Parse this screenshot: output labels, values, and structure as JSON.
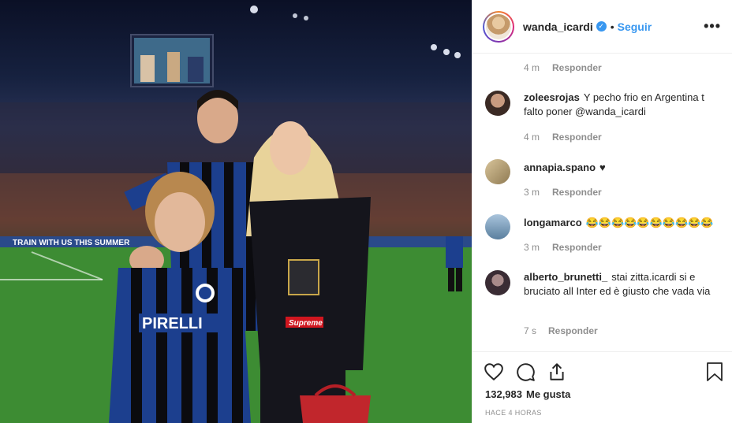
{
  "post": {
    "photo_alt": "",
    "banner_text": "TRAIN WITH US THIS SUMMER",
    "shirt_sponsor": "PIRELLI",
    "bag_label": "Supreme"
  },
  "header": {
    "username": "wanda_icardi",
    "verified_mark": "✓",
    "separator": "•",
    "follow_label": "Seguir",
    "more_label": "•••"
  },
  "comments": [
    {
      "username": "",
      "text": "",
      "time": "4 m",
      "reply_label": "Responder",
      "avatar_color": "#ffffff"
    },
    {
      "username": "zoleesrojas",
      "text": "Y pecho frio en Argentina t falto poner @wanda_icardi",
      "time": "4 m",
      "reply_label": "Responder",
      "avatar_color": "#6b4a3a"
    },
    {
      "username": "annapia.spano",
      "text": "♥",
      "time": "3 m",
      "reply_label": "Responder",
      "avatar_color": "#b8a27c"
    },
    {
      "username": "longamarco",
      "text": "😂😂😂😂😂😂😂😂😂😂",
      "time": "3 m",
      "reply_label": "Responder",
      "avatar_color": "#7aa0c4"
    },
    {
      "username": "alberto_brunetti_",
      "text": "stai zitta.icardi si e bruciato all Inter ed è giusto che vada via",
      "time": "7 s",
      "reply_label": "Responder",
      "avatar_color": "#4b3a44"
    }
  ],
  "actions": {
    "like_icon": "heart-icon",
    "comment_icon": "comment-icon",
    "share_icon": "share-icon",
    "save_icon": "bookmark-icon"
  },
  "likes": {
    "count": "132,983",
    "label": "Me gusta"
  },
  "timestamp": "HACE 4 HORAS",
  "colors": {
    "link_blue": "#3897f0",
    "text": "#262626",
    "muted": "#8e8e8e",
    "border": "#efefef"
  }
}
